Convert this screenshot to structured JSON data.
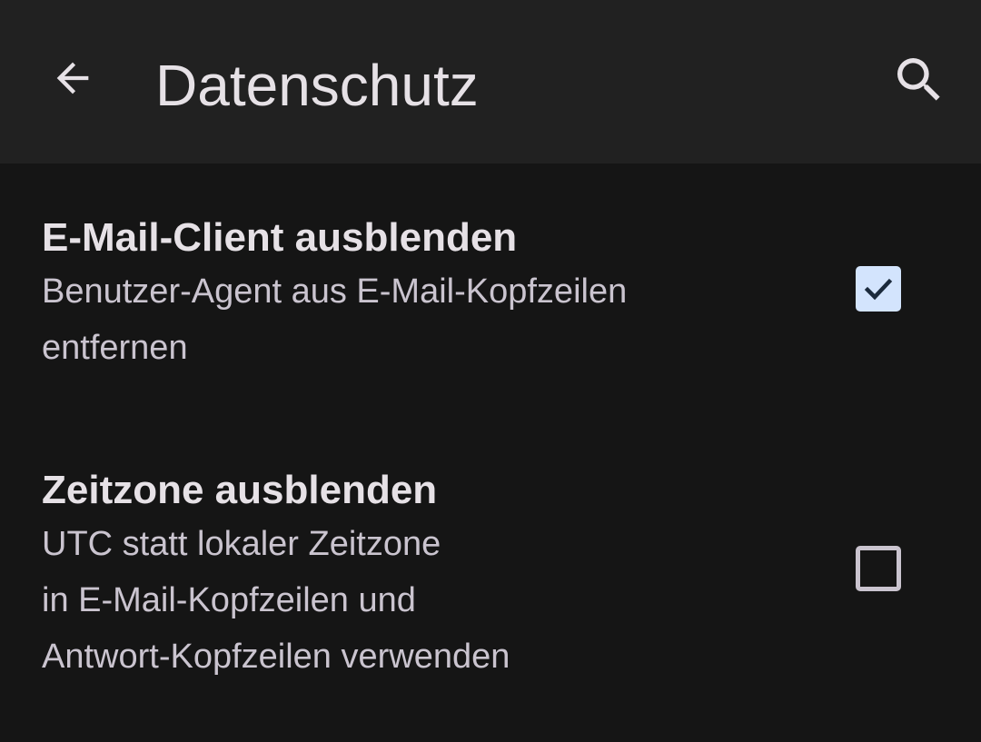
{
  "toolbar": {
    "title": "Datenschutz",
    "back_icon": "arrow-back-icon",
    "search_icon": "search-icon"
  },
  "preferences": [
    {
      "title": "E-Mail-Client ausblenden",
      "summary_lines": [
        "Benutzer-Agent aus E-Mail-Kopfzeilen",
        "entfernen"
      ],
      "checked": true
    },
    {
      "title": "Zeitzone ausblenden",
      "summary_lines": [
        "UTC statt lokaler Zeitzone",
        "in E-Mail-Kopfzeilen und",
        "Antwort-Kopfzeilen verwenden"
      ],
      "checked": false
    }
  ],
  "colors": {
    "background": "#151515",
    "toolbar": "#212121",
    "checkbox_checked_fill": "#d3e4fd",
    "checkmark": "#1b2a3c",
    "text_primary": "#e6e1e6",
    "text_secondary": "#cac4cf"
  }
}
